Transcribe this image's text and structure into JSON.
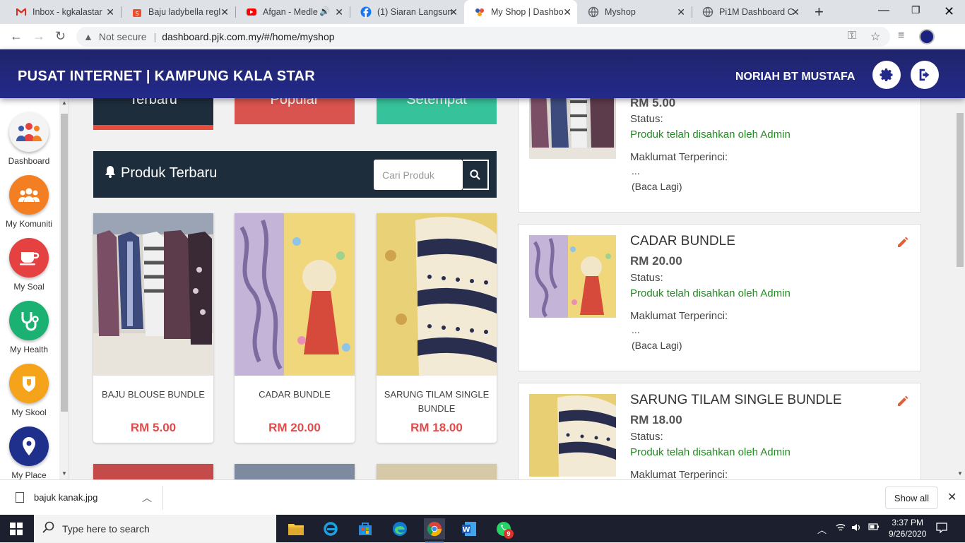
{
  "browser": {
    "tabs": [
      {
        "title": "Inbox - kgkalastar",
        "icon": "gmail-icon",
        "color": "#d93025"
      },
      {
        "title": "Baju ladybella regl",
        "icon": "shopee-icon",
        "color": "#ee4d2d"
      },
      {
        "title": "Afgan - Medle",
        "icon": "youtube-icon",
        "color": "#ff0000"
      },
      {
        "title": "(1) Siaran Langsun",
        "icon": "facebook-icon",
        "color": "#1877f2"
      },
      {
        "title": "My Shop | Dashbo",
        "icon": "pi1m-icon",
        "color": "#3a5ba9"
      },
      {
        "title": "Myshop",
        "icon": "globe-icon",
        "color": "#5f6368"
      },
      {
        "title": "Pi1M Dashboard C",
        "icon": "globe-icon",
        "color": "#5f6368"
      }
    ],
    "url_warning": "Not secure",
    "url": "dashboard.pjk.com.my/#/home/myshop"
  },
  "header": {
    "title": "PUSAT INTERNET |  KAMPUNG KALA STAR",
    "user": "NORIAH BT MUSTAFA"
  },
  "sidebar": {
    "items": [
      {
        "label": "Dashboard",
        "icon": "community-people-icon",
        "color": "#f4f4f4"
      },
      {
        "label": "My Komuniti",
        "icon": "group-icon",
        "color": "#f37f22"
      },
      {
        "label": "My Soal",
        "icon": "coffee-cup-icon",
        "color": "#e64141"
      },
      {
        "label": "My Health",
        "icon": "stethoscope-icon",
        "color": "#1bb173"
      },
      {
        "label": "My Skool",
        "icon": "shield-icon",
        "color": "#f5a31a"
      },
      {
        "label": "My Place",
        "icon": "map-pin-icon",
        "color": "#1f2f8c"
      }
    ]
  },
  "filters": [
    {
      "label": "Terbaru",
      "color": "#1e2d3b",
      "accent": "#e74c3c"
    },
    {
      "label": "Popular",
      "color": "#d9534f"
    },
    {
      "label": "Setempat",
      "color": "#36c29a"
    }
  ],
  "panel": {
    "title": "Produk Terbaru",
    "search_placeholder": "Cari Produk"
  },
  "products": [
    {
      "name": "BAJU BLOUSE BUNDLE",
      "price": "RM 5.00"
    },
    {
      "name": "CADAR BUNDLE",
      "price": "RM 20.00"
    },
    {
      "name": "SARUNG TILAM SINGLE BUNDLE",
      "price": "RM 18.00"
    }
  ],
  "my_products": [
    {
      "name": "",
      "price": "RM 5.00",
      "status_label": "Status:",
      "status": "Produk telah disahkan oleh Admin",
      "detail_label": "Maklumat Terperinci:",
      "detail": "...",
      "more": "(Baca Lagi)"
    },
    {
      "name": "CADAR BUNDLE",
      "price": "RM 20.00",
      "status_label": "Status:",
      "status": "Produk telah disahkan oleh Admin",
      "detail_label": "Maklumat Terperinci:",
      "detail": "...",
      "more": "(Baca Lagi)"
    },
    {
      "name": "SARUNG TILAM SINGLE BUNDLE",
      "price": "RM 18.00",
      "status_label": "Status:",
      "status": "Produk telah disahkan oleh Admin",
      "detail_label": "Maklumat Terperinci:"
    }
  ],
  "downloads": {
    "file": "bajuk kanak.jpg",
    "show_all": "Show all"
  },
  "taskbar": {
    "search_placeholder": "Type here to search",
    "time": "3:37 PM",
    "date": "9/26/2020",
    "whatsapp_badge": "9"
  }
}
